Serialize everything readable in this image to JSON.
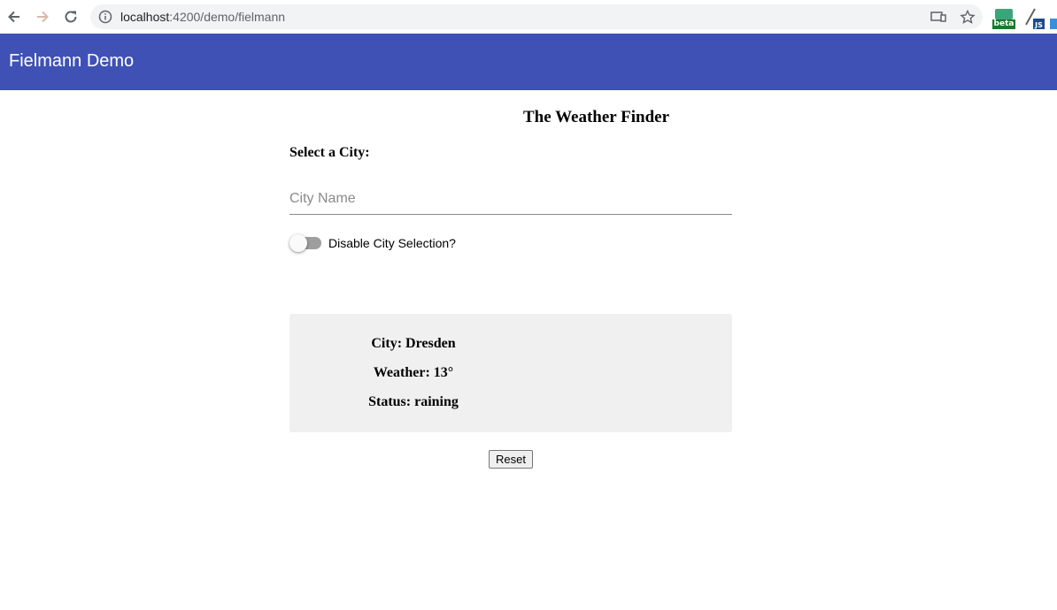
{
  "browser": {
    "url_host": "localhost",
    "url_path": ":4200/demo/fielmann",
    "icons": [
      "back-arrow-icon",
      "forward-arrow-icon",
      "reload-icon",
      "info-icon",
      "cast-icon",
      "star-icon"
    ],
    "extension_beta_label": "beta",
    "extension_js_label": "JS"
  },
  "toolbar": {
    "title": "Fielmann Demo",
    "color": "#3f51b5"
  },
  "main": {
    "heading": "The Weather Finder",
    "select_label": "Select a City:",
    "city_input": {
      "placeholder": "City Name",
      "value": ""
    },
    "toggle": {
      "label": "Disable City Selection?",
      "checked": false
    },
    "weather": {
      "city_line": "City: Dresden",
      "weather_line": "Weather: 13°",
      "status_line": "Status: raining"
    },
    "reset_label": "Reset"
  }
}
